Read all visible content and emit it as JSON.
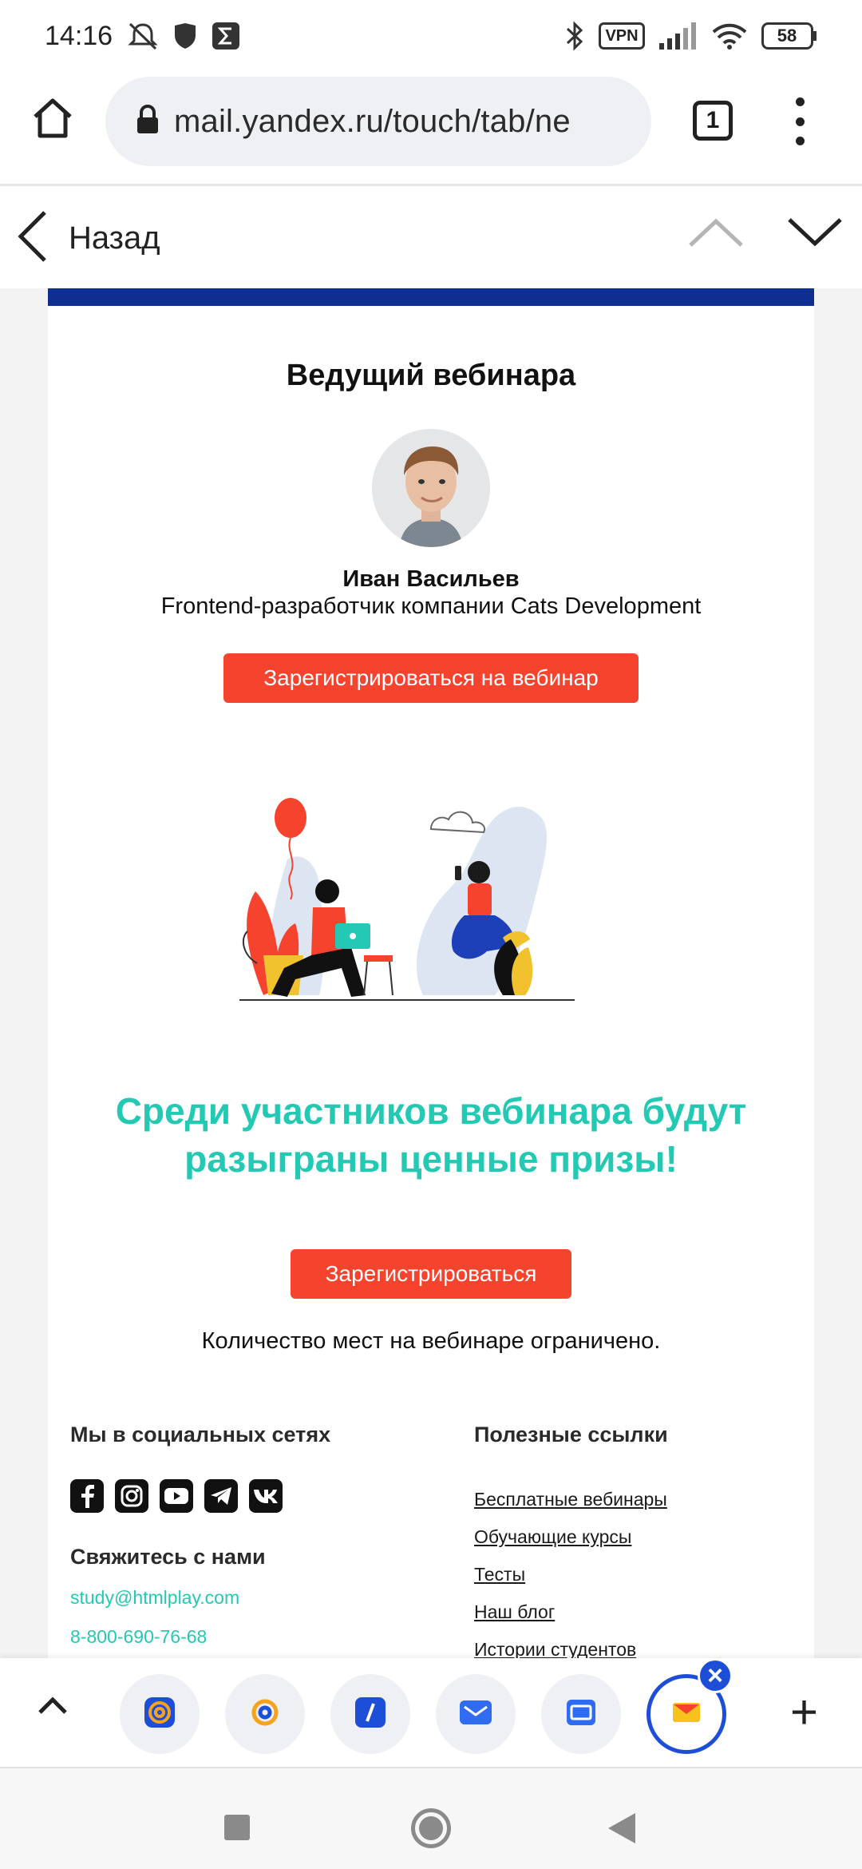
{
  "status_bar": {
    "time": "14:16",
    "vpn_label": "VPN",
    "battery": "58",
    "icons": [
      "mute-icon",
      "shield-icon",
      "sigma-icon",
      "bluetooth-icon",
      "signal-icon",
      "wifi-icon",
      "battery-icon"
    ]
  },
  "browser": {
    "url": "mail.yandex.ru/touch/tab/ne",
    "tab_count": "1"
  },
  "nav": {
    "back_label": "Назад"
  },
  "email": {
    "host_title": "Ведущий вебинара",
    "host_name": "Иван Васильев",
    "host_role": "Frontend-разработчик компании Cats Development",
    "register_webinar_button": "Зарегистрироваться на вебинар",
    "prize_heading": "Среди участников вебинара будут разыграны ценные призы!",
    "register_button": "Зарегистрироваться",
    "limited_text": "Количество мест на вебинаре ограничено.",
    "colors": {
      "accent_teal": "#23c9b2",
      "button_red": "#f5432e",
      "header_blue": "#0f2e91"
    }
  },
  "footer": {
    "social_heading": "Мы в социальных сетях",
    "social_icons": [
      "facebook-icon",
      "instagram-icon",
      "youtube-icon",
      "telegram-icon",
      "vk-icon"
    ],
    "contact_heading": "Свяжитесь с нами",
    "email": "study@htmlplay.com",
    "phone": "8-800-690-76-68",
    "links_heading": "Полезные ссылки",
    "links": [
      "Бесплатные вебинары",
      "Обучающие курсы",
      "Тесты",
      "Наш блог",
      "Истории студентов"
    ]
  },
  "tab_strip": {
    "tabs": [
      "mail-at-icon",
      "mail-at-icon",
      "slash-icon",
      "mail-envelope-icon",
      "mail-inbox-icon",
      "yandex-mail-icon"
    ],
    "close_label": "×",
    "add_label": "+"
  }
}
